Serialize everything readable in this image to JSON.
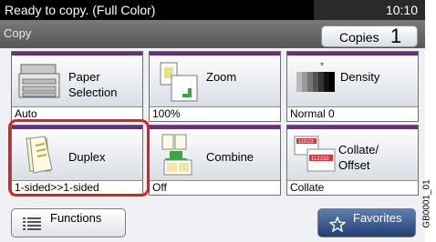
{
  "status": {
    "message": "Ready to copy. (Full Color)",
    "time": "10:10"
  },
  "header": {
    "title": "Copy",
    "copies_label": "Copies",
    "copies_value": "1"
  },
  "tiles": [
    {
      "label_line1": "Paper",
      "label_line2": "Selection",
      "value": "Auto",
      "icon": "paper-selection-icon"
    },
    {
      "label_line1": "Zoom",
      "label_line2": "",
      "value": "100%",
      "icon": "zoom-icon"
    },
    {
      "label_line1": "Density",
      "label_line2": "",
      "value": "Normal 0",
      "icon": "density-icon"
    },
    {
      "label_line1": "Duplex",
      "label_line2": "",
      "value": "1-sided>>1-sided",
      "icon": "duplex-icon"
    },
    {
      "label_line1": "Combine",
      "label_line2": "",
      "value": "Off",
      "icon": "combine-icon"
    },
    {
      "label_line1": "Collate/",
      "label_line2": "Offset",
      "value": "Collate",
      "icon": "collate-offset-icon"
    }
  ],
  "bottom": {
    "functions_label": "Functions",
    "favorites_label": "Favorites"
  },
  "image_code": "GB0001_01",
  "colors": {
    "tile_accent": "#6c2a83",
    "highlight": "#e0201c",
    "favorites_bg": "#2a4a80",
    "statusbar": "#000000"
  }
}
